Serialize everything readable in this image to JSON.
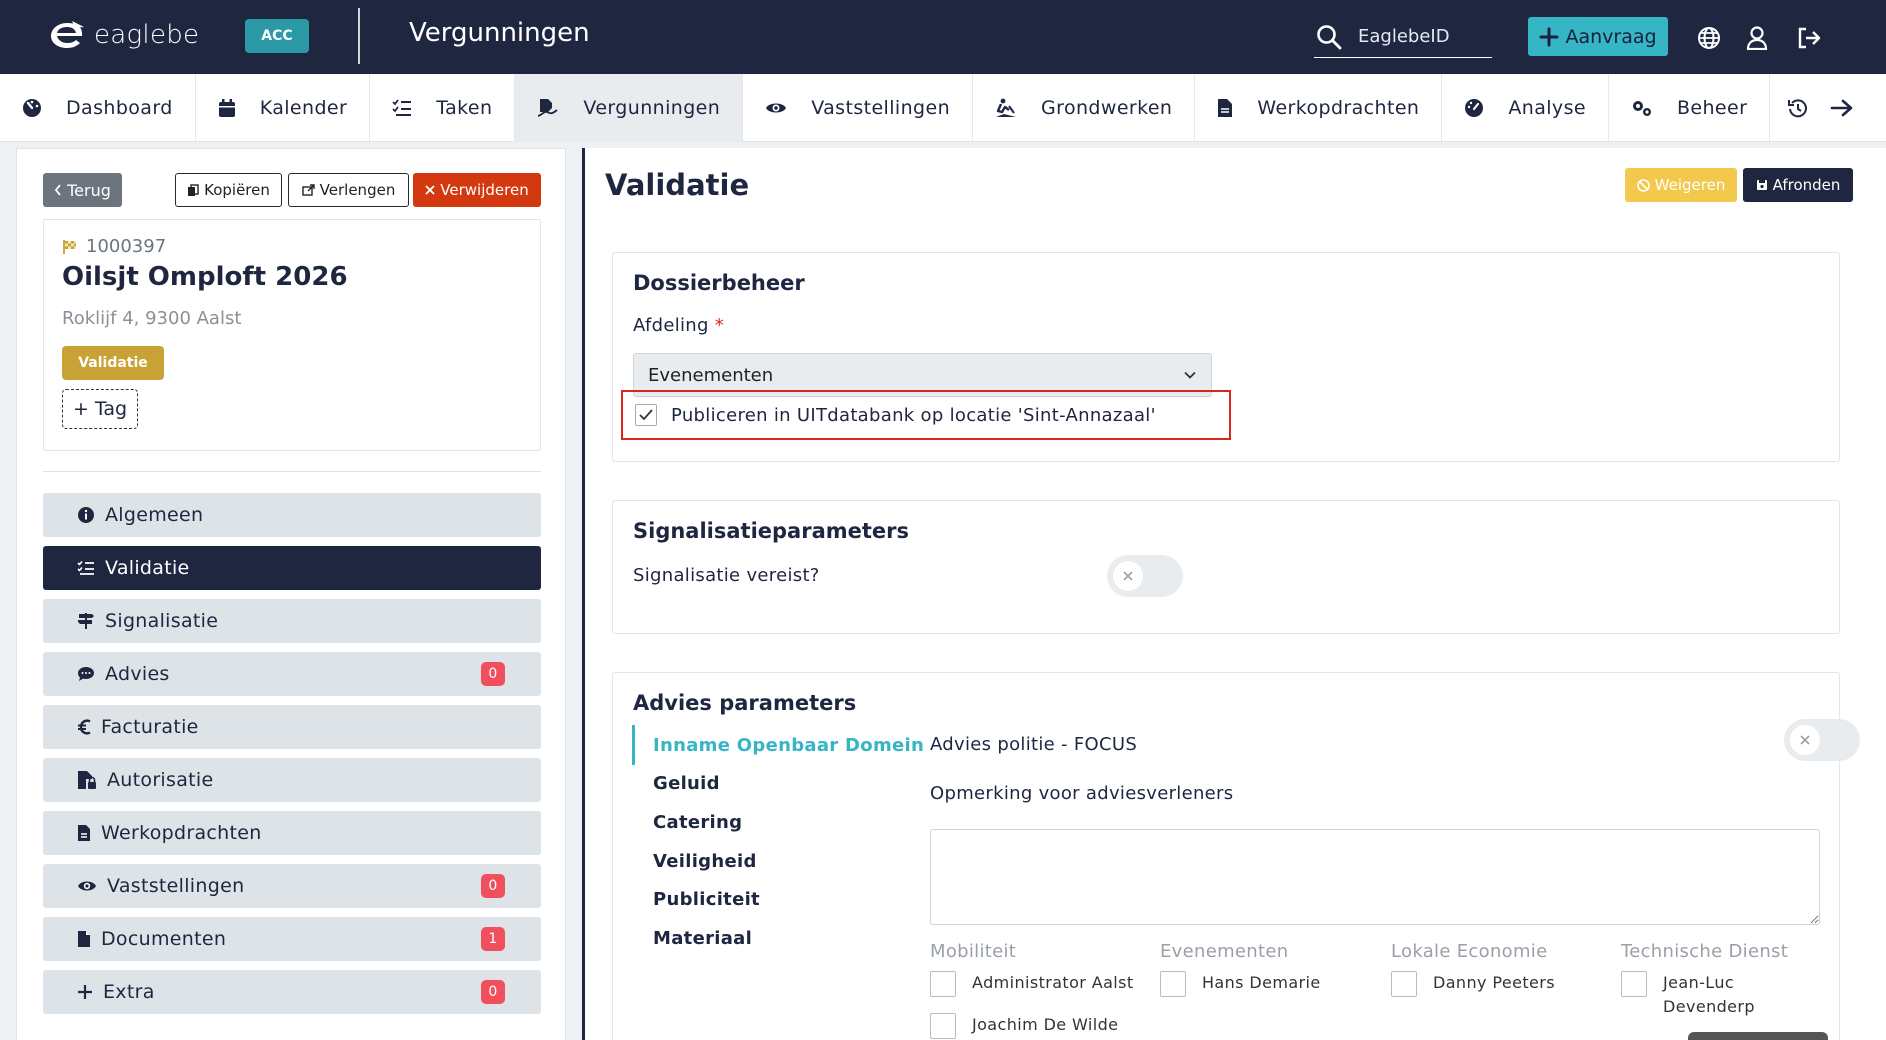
{
  "topbar": {
    "logo_text": "eaglebe",
    "env_badge": "ACC",
    "app_title": "Vergunningen",
    "search_placeholder": "EaglebeID",
    "aanvraag_label": "Aanvraag"
  },
  "nav": [
    {
      "label": "Dashboard",
      "icon": "dashboard-icon"
    },
    {
      "label": "Kalender",
      "icon": "calendar-icon"
    },
    {
      "label": "Taken",
      "icon": "tasks-icon"
    },
    {
      "label": "Vergunningen",
      "icon": "signature-icon",
      "active": true
    },
    {
      "label": "Vaststellingen",
      "icon": "eye-icon"
    },
    {
      "label": "Grondwerken",
      "icon": "digging-icon"
    },
    {
      "label": "Werkopdrachten",
      "icon": "file-icon"
    },
    {
      "label": "Analyse",
      "icon": "gauge-icon"
    },
    {
      "label": "Beheer",
      "icon": "cogs-icon"
    }
  ],
  "left": {
    "terug": "Terug",
    "kopieren": "Kopiëren",
    "verlengen": "Verlengen",
    "verwijderen": "Verwijderen",
    "dossier_number": "1000397",
    "dossier_title": "Oilsjt Omploft 2026",
    "dossier_address": "Roklijf 4, 9300 Aalst",
    "status": "Validatie",
    "tag_button": "+ Tag",
    "menu": [
      {
        "label": "Algemeen",
        "icon": "info-icon",
        "badge": null
      },
      {
        "label": "Validatie",
        "icon": "list-check-icon",
        "badge": null,
        "active": true
      },
      {
        "label": "Signalisatie",
        "icon": "signs-icon",
        "badge": null
      },
      {
        "label": "Advies",
        "icon": "comment-icon",
        "badge": "0"
      },
      {
        "label": "Facturatie",
        "icon": "euro-icon",
        "badge": null
      },
      {
        "label": "Autorisatie",
        "icon": "file-lock-icon",
        "badge": null
      },
      {
        "label": "Werkopdrachten",
        "icon": "file-icon",
        "badge": null
      },
      {
        "label": "Vaststellingen",
        "icon": "eye-icon",
        "badge": "0"
      },
      {
        "label": "Documenten",
        "icon": "document-icon",
        "badge": "1"
      },
      {
        "label": "Extra",
        "icon": "plus-icon",
        "badge": "0"
      }
    ]
  },
  "main": {
    "title": "Validatie",
    "weigeren": "Weigeren",
    "afronden": "Afronden",
    "dossierbeheer": {
      "title": "Dossierbeheer",
      "afdeling_label": "Afdeling",
      "afdeling_required": "*",
      "afdeling_value": "Evenementen",
      "publiceer_label": "Publiceren in UITdatabank op locatie 'Sint-Annazaal'",
      "publiceer_checked": true
    },
    "signalisatie": {
      "title": "Signalisatieparameters",
      "vereist_label": "Signalisatie vereist?",
      "vereist_on": false
    },
    "advies": {
      "title": "Advies parameters",
      "tabs": [
        "Inname Openbaar Domein",
        "Geluid",
        "Catering",
        "Veiligheid",
        "Publiciteit",
        "Materiaal"
      ],
      "active_tab": "Inname Openbaar Domein",
      "politie_label": "Advies politie - FOCUS",
      "politie_on": false,
      "opmerking_label": "Opmerking voor adviesverleners",
      "opmerking_value": "",
      "columns": [
        {
          "head": "Mobiliteit",
          "people": [
            "Administrator Aalst",
            "Joachim De Wilde"
          ]
        },
        {
          "head": "Evenementen",
          "people": [
            "Hans Demarie"
          ]
        },
        {
          "head": "Lokale Economie",
          "people": [
            "Danny Peeters"
          ]
        },
        {
          "head": "Technische Dienst",
          "people": [
            "Jean-Luc Devenderp"
          ]
        }
      ]
    }
  },
  "colors": {
    "navy": "#1e2640",
    "teal": "#36b5c4",
    "accent_badge": "#2c9aa6",
    "danger": "#d3380f",
    "warning": "#f2c94c",
    "status": "#c9a235",
    "highlight": "#d9251d"
  }
}
